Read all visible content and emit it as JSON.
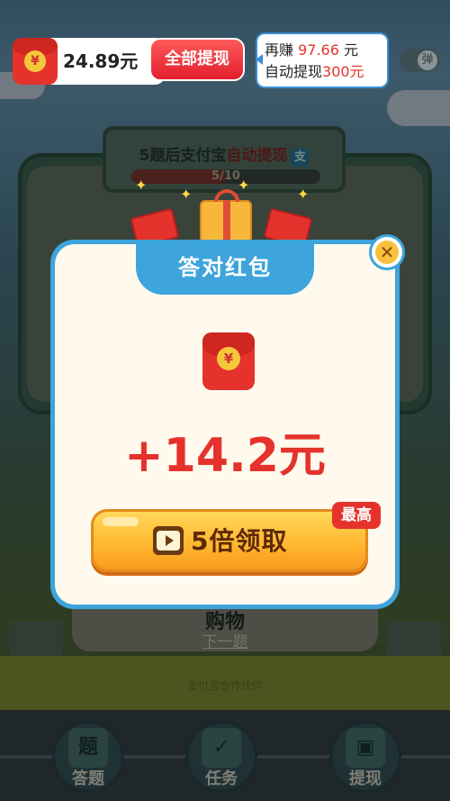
{
  "topbar": {
    "balance": "24.89元",
    "withdraw_all_label": "全部提现",
    "earn_prefix": "再赚",
    "earn_amount": "97.66",
    "earn_unit": "元",
    "auto_prefix": "自动提现",
    "auto_amount": "300元",
    "toggle_label": "弹",
    "balance_icon": "red-envelope-icon",
    "envelope_symbol": "¥"
  },
  "quiz": {
    "progress_prefix": "5题后支付宝",
    "progress_highlight": "自动提现",
    "alipay_symbol": "支",
    "progress_text": "5/10",
    "progress_value": 0.5,
    "answer_text": "购物",
    "next_label": "下一题",
    "field_text": "支付宝合作伙伴"
  },
  "modal": {
    "title": "答对红包",
    "reward_amount": "+14.2元",
    "claim_label": "5倍领取",
    "best_badge": "最高",
    "close_symbol": "✕",
    "envelope_icon": "red-envelope-icon",
    "claim_icon": "video-play-icon"
  },
  "bottom_nav": [
    {
      "label": "答题",
      "icon_text": "题"
    },
    {
      "label": "任务",
      "icon_text": "✓"
    },
    {
      "label": "提现",
      "icon_text": "▣"
    }
  ],
  "colors": {
    "accent_red": "#e5322c",
    "modal_blue": "#3ea4dc",
    "button_orange": "#ffb52e"
  }
}
